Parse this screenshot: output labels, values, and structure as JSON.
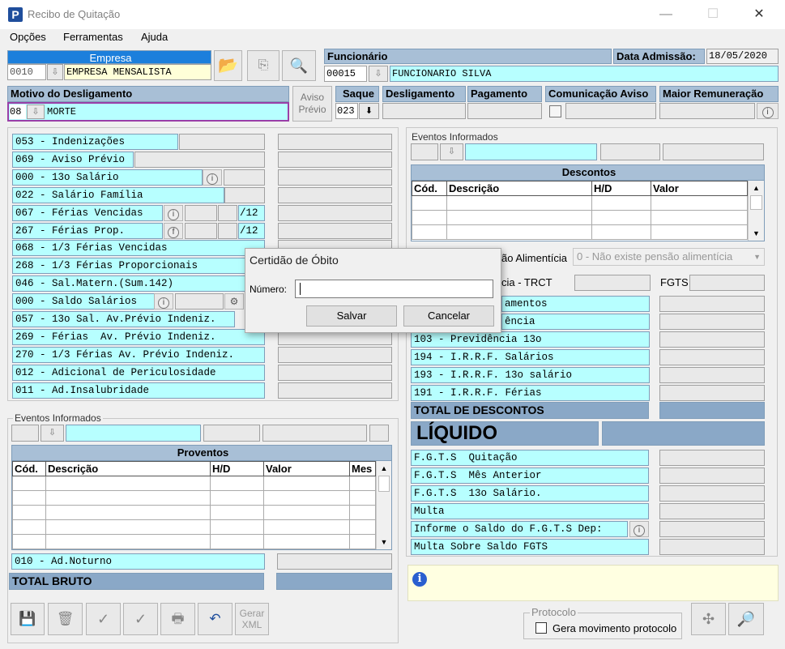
{
  "window": {
    "title": "Recibo de Quitação",
    "min": "—",
    "max": "☐",
    "close": "✕",
    "app_letter": "P"
  },
  "menu": [
    "Opções",
    "Ferramentas",
    "Ajuda"
  ],
  "empresa": {
    "header": "Empresa",
    "code": "0010",
    "name": "EMPRESA MENSALISTA"
  },
  "funcionario": {
    "header": "Funcionário",
    "code": "00015",
    "name": "FUNCIONARIO SILVA",
    "admissao_label": "Data Admissão:",
    "admissao": "18/05/2020"
  },
  "motivo": {
    "header": "Motivo do Desligamento",
    "code": "08",
    "desc": "MORTE"
  },
  "aviso_previo_btn": "Aviso\nPrévio",
  "saque": {
    "header": "Saque",
    "code": "023"
  },
  "cols": {
    "desligamento": "Desligamento",
    "pagamento": "Pagamento",
    "comunicacao": "Comunicação Aviso",
    "maior": "Maior Remuneração"
  },
  "left_rows": [
    "053 - Indenizações",
    "069 - Aviso Prévio",
    "000 - 13o Salário",
    "022 - Salário Família",
    "067 - Férias Vencidas",
    "267 - Férias Prop.",
    "068 - 1/3 Férias Vencidas",
    "268 - 1/3 Férias Proporcionais",
    "046 - Sal.Matern.(Sum.142)",
    "000 - Saldo Salários",
    "057 - 13o Sal. Av.Prévio Indeniz.",
    "269 - Férias  Av. Prévio Indeniz.",
    "270 - 1/3 Férias Av. Prévio Indeniz.",
    "012 - Adicional de Periculosidade",
    "011 - Ad.Insalubridade"
  ],
  "frac12": "/12",
  "eventos_label": "Eventos Informados",
  "proventos": {
    "title": "Proventos",
    "cols": [
      "Cód.",
      "Descrição",
      "H/D",
      "Valor",
      "Mes"
    ]
  },
  "noturno": "010 - Ad.Noturno",
  "total_bruto": "TOTAL BRUTO",
  "bottom_buttons": {
    "gerar": "Gerar\nXML"
  },
  "descontos": {
    "title": "Descontos",
    "cols": [
      "Cód.",
      "Descrição",
      "H/D",
      "Valor"
    ]
  },
  "pensao": {
    "label": "ão Alimentícia",
    "value": "0 - Não existe pensão alimentícia"
  },
  "trct_label": "cia - TRCT",
  "fgts_label": "FGTS",
  "right_rows": [
    "amentos",
    "ência",
    "103 - Previdência 13o",
    "194 - I.R.R.F. Salários",
    "193 - I.R.R.F. 13o salário",
    "191 - I.R.R.F. Férias"
  ],
  "total_descontos": "TOTAL DE DESCONTOS",
  "liquido": "LÍQUIDO",
  "fgts_rows": [
    "F.G.T.S  Quitação",
    "F.G.T.S  Mês Anterior",
    "F.G.T.S  13o Salário.",
    "Multa",
    "Informe o Saldo do F.G.T.S Dep:",
    "Multa Sobre Saldo FGTS"
  ],
  "protocolo": {
    "label": "Protocolo",
    "checkbox": "Gera movimento protocolo"
  },
  "dialog": {
    "title": "Certidão de Óbito",
    "label": "Número:",
    "value": "",
    "save": "Salvar",
    "cancel": "Cancelar"
  },
  "info_glyph": "i"
}
